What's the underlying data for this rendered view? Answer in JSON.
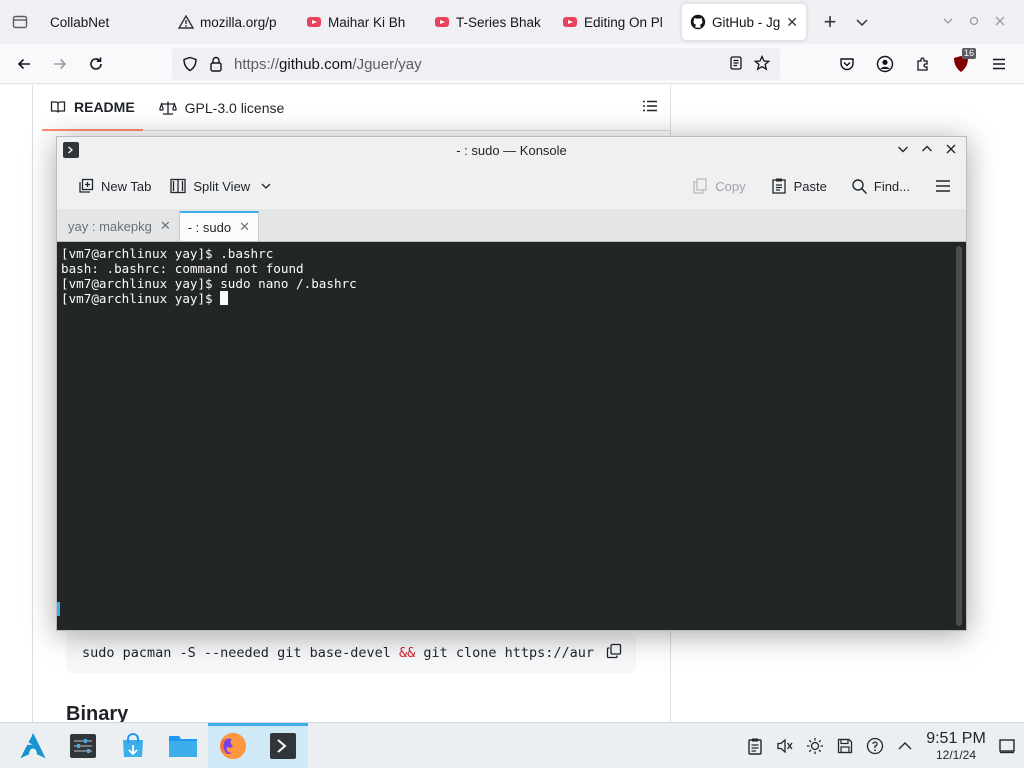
{
  "browser": {
    "tabs": [
      {
        "label": "CollabNet",
        "favicon": "none"
      },
      {
        "label": "mozilla.org/p",
        "favicon": "warning-icon"
      },
      {
        "label": "Maihar Ki Bh",
        "favicon": "youtube-icon"
      },
      {
        "label": "T-Series Bhak",
        "favicon": "youtube-icon"
      },
      {
        "label": "Editing On Pl",
        "favicon": "youtube-icon"
      },
      {
        "label": "GitHub - Jg",
        "favicon": "github-icon",
        "selected": true
      }
    ],
    "url_prefix": "https://",
    "url_host": "github.com",
    "url_path": "/Jguer/yay",
    "extension_badge": "16"
  },
  "github": {
    "readme_tab": "README",
    "license_tab": "GPL-3.0 license",
    "code_line_part1": "sudo pacman -S --needed git base-devel ",
    "code_amp": "&&",
    "code_line_part2": " git clone https://aur",
    "binary_heading": "Binary"
  },
  "konsole": {
    "title": "- : sudo — Konsole",
    "toolbar": {
      "new_tab": "New Tab",
      "split_view": "Split View",
      "copy": "Copy",
      "paste": "Paste",
      "find": "Find..."
    },
    "tabs": [
      {
        "label": "yay : makepkg"
      },
      {
        "label": "- : sudo",
        "active": true
      }
    ],
    "lines": [
      "[vm7@archlinux yay]$ .bashrc",
      "bash: .bashrc: command not found",
      "[vm7@archlinux yay]$ sudo nano /.bashrc",
      "[vm7@archlinux yay]$ "
    ]
  },
  "panel": {
    "time": "9:51 PM",
    "date": "12/1/24"
  },
  "colors": {
    "accent": "#3daee9",
    "terminal_bg": "#232627",
    "youtube_red": "#e8425c"
  }
}
